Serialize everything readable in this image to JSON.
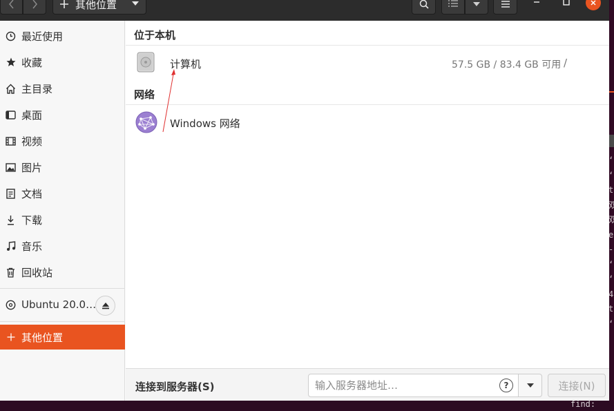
{
  "window": {
    "path_label": "其他位置",
    "accent_color": "#e95420"
  },
  "headerbar": {
    "icons": [
      "chevron-left-icon",
      "chevron-right-icon",
      "plus-icon",
      "chevron-down-icon",
      "search-icon",
      "list-view-icon",
      "chevron-down-icon",
      "hamburger-menu-icon",
      "minimize-icon",
      "maximize-icon",
      "close-icon"
    ]
  },
  "sidebar": {
    "items": [
      {
        "label": "最近使用",
        "icon": "clock-icon"
      },
      {
        "label": "收藏",
        "icon": "star-icon"
      },
      {
        "label": "主目录",
        "icon": "home-icon"
      },
      {
        "label": "桌面",
        "icon": "desktop-icon"
      },
      {
        "label": "视频",
        "icon": "film-icon"
      },
      {
        "label": "图片",
        "icon": "image-icon"
      },
      {
        "label": "文档",
        "icon": "document-icon"
      },
      {
        "label": "下载",
        "icon": "download-icon"
      },
      {
        "label": "音乐",
        "icon": "music-icon"
      },
      {
        "label": "回收站",
        "icon": "trash-icon"
      }
    ],
    "device": {
      "label": "Ubuntu 20.0…",
      "icon": "disc-icon"
    },
    "other_locations": {
      "label": "其他位置",
      "icon": "plus-icon"
    }
  },
  "main": {
    "this_computer_title": "位于本机",
    "computer": {
      "name": "计算机",
      "usage": "57.5 GB / 83.4 GB 可用",
      "mount": "/"
    },
    "network_title": "网络",
    "network": {
      "name": "Windows 网络"
    }
  },
  "bottombar": {
    "connect_label": "连接到服务器(S)",
    "address_placeholder": "输入服务器地址…",
    "address_value": "",
    "connect_button": "连接(N)"
  },
  "background_terminal": {
    "status_char": "l",
    "visible_chars": "‘\n‘\nt\n双\n双\ne\n-\n‘\n‘\n4\nt\n‘",
    "bottom_text": "find:"
  }
}
